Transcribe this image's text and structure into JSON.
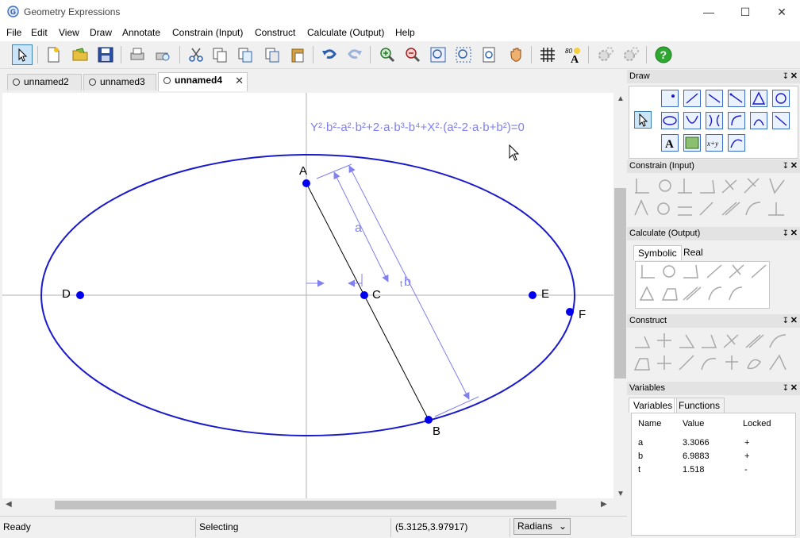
{
  "window": {
    "title": "Geometry Expressions",
    "minimize": "—",
    "maximize": "☐",
    "close": "✕"
  },
  "menu": [
    "File",
    "Edit",
    "View",
    "Draw",
    "Annotate",
    "Constrain (Input)",
    "Construct",
    "Calculate (Output)",
    "Help"
  ],
  "toolbar": [
    "select-icon",
    "new-icon",
    "open-icon",
    "save-icon",
    "print-icon",
    "print-preview-icon",
    "cut-icon",
    "copy-icon",
    "copy-special-icon",
    "paste-special-icon",
    "paste-icon",
    "undo-icon",
    "redo-icon",
    "zoom-in-icon",
    "zoom-out-icon",
    "zoom-fit-icon",
    "zoom-window-icon",
    "zoom-page-icon",
    "pan-hand-icon",
    "grid-icon",
    "label-font-icon",
    "gears-icon",
    "gears-2-icon",
    "help-icon"
  ],
  "tabs": [
    {
      "label": "unnamed2",
      "active": false
    },
    {
      "label": "unnamed3",
      "active": false
    },
    {
      "label": "unnamed4",
      "active": true,
      "close": "✕"
    }
  ],
  "canvas": {
    "equation": "Y²·b²-a²·b²+2·a·b³-b⁴+X²·(a²-2·a·b+b²)=0",
    "points": {
      "A": "A",
      "B": "B",
      "C": "C",
      "D": "D",
      "E": "E",
      "F": "F"
    },
    "dimension_a": "a",
    "dimension_tb": "t",
    "dimension_tb2": "b",
    "colors": {
      "ellipse": "#1a1acc",
      "point": "#0000ee",
      "annotation": "#8080ee",
      "axis": "#b0b0b0"
    }
  },
  "status": {
    "ready": "Ready",
    "mode": "Selecting",
    "coords": "(5.3125,3.97917)",
    "angle_unit": "Radians"
  },
  "panels": {
    "draw": {
      "title": "Draw",
      "pin": "↧",
      "close": "✕"
    },
    "constrain": {
      "title": "Constrain (Input)",
      "pin": "↧",
      "close": "✕"
    },
    "calculate": {
      "title": "Calculate (Output)",
      "pin": "↧",
      "close": "✕",
      "tabs": [
        "Symbolic",
        "Real"
      ]
    },
    "construct": {
      "title": "Construct",
      "pin": "↧",
      "close": "✕"
    },
    "variables": {
      "title": "Variables",
      "pin": "↧",
      "close": "✕",
      "tabs": [
        "Variables",
        "Functions"
      ],
      "columns": [
        "Name",
        "Value",
        "Locked"
      ],
      "rows": [
        {
          "name": "a",
          "value": "3.3066",
          "locked": "+"
        },
        {
          "name": "b",
          "value": "6.9883",
          "locked": "+"
        },
        {
          "name": "t",
          "value": "1.518",
          "locked": "-"
        }
      ]
    }
  }
}
